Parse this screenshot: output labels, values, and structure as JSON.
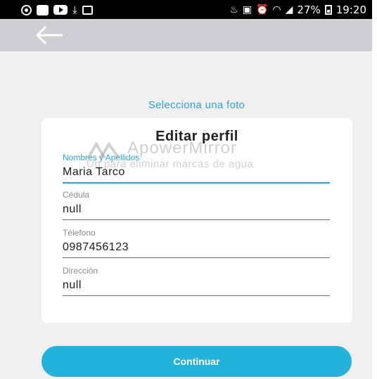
{
  "status_bar": {
    "left_icons": [
      "whatsapp-icon",
      "notification-square-icon",
      "youtube-icon",
      "download-icon",
      "image-icon"
    ],
    "right_icons": [
      "alarm-icon",
      "nfc-icon",
      "alarm-clock-icon",
      "wifi-icon",
      "signal-icon",
      "battery-icon"
    ],
    "battery_percent": "27%",
    "time": "19:20"
  },
  "app_bar": {
    "back_icon": "arrow-left-icon",
    "background": "#cfcfd3"
  },
  "photo_link": "Selecciona una foto",
  "card": {
    "title": "Editar perfil",
    "fields": [
      {
        "label": "Nombres y Apellidos",
        "value": "Maria Tarco",
        "active": true
      },
      {
        "label": "Cédula",
        "value": "null",
        "active": false
      },
      {
        "label": "Télefono",
        "value": "0987456123",
        "active": false
      },
      {
        "label": "Dirección",
        "value": "null",
        "active": false
      }
    ]
  },
  "watermark": {
    "title": "ApowerMirror",
    "subtitle": "Up para eliminar marcas de agua"
  },
  "continue_button": "Continuar",
  "colors": {
    "accent": "#2ea2d6",
    "button": "#23b2da",
    "background": "#f0f0f1"
  }
}
